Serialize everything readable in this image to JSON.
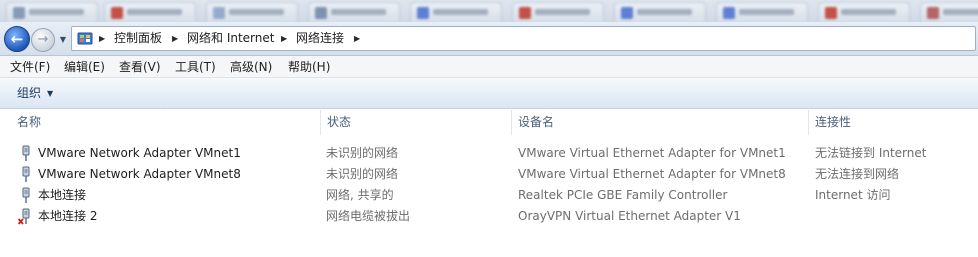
{
  "breadcrumb": [
    "控制面板",
    "网络和 Internet",
    "网络连接"
  ],
  "menu": [
    "文件(F)",
    "编辑(E)",
    "查看(V)",
    "工具(T)",
    "高级(N)",
    "帮助(H)"
  ],
  "command_bar": {
    "organize_label": "组织"
  },
  "columns": [
    "名称",
    "状态",
    "设备名",
    "连接性"
  ],
  "rows": [
    {
      "name": "VMware Network Adapter VMnet1",
      "status": "未识别的网络",
      "device": "VMware Virtual Ethernet Adapter for VMnet1",
      "connectivity": "无法链接到 Internet",
      "icon": "network-adapter-icon"
    },
    {
      "name": "VMware Network Adapter VMnet8",
      "status": "未识别的网络",
      "device": "VMware Virtual Ethernet Adapter for VMnet8",
      "connectivity": "无法连接到网络",
      "icon": "network-adapter-icon"
    },
    {
      "name": "本地连接",
      "status": "网络, 共享的",
      "device": "Realtek PCIe GBE Family Controller",
      "connectivity": "Internet 访问",
      "icon": "network-adapter-icon"
    },
    {
      "name": "本地连接 2",
      "status": "网络电缆被拔出",
      "device": "OrayVPN Virtual Ethernet Adapter V1",
      "connectivity": "",
      "icon": "network-adapter-disconnected-icon"
    }
  ],
  "colors": {
    "header_text": "#4c607a",
    "accent": "#1d58b8",
    "disconnected": "#d11a1a"
  }
}
